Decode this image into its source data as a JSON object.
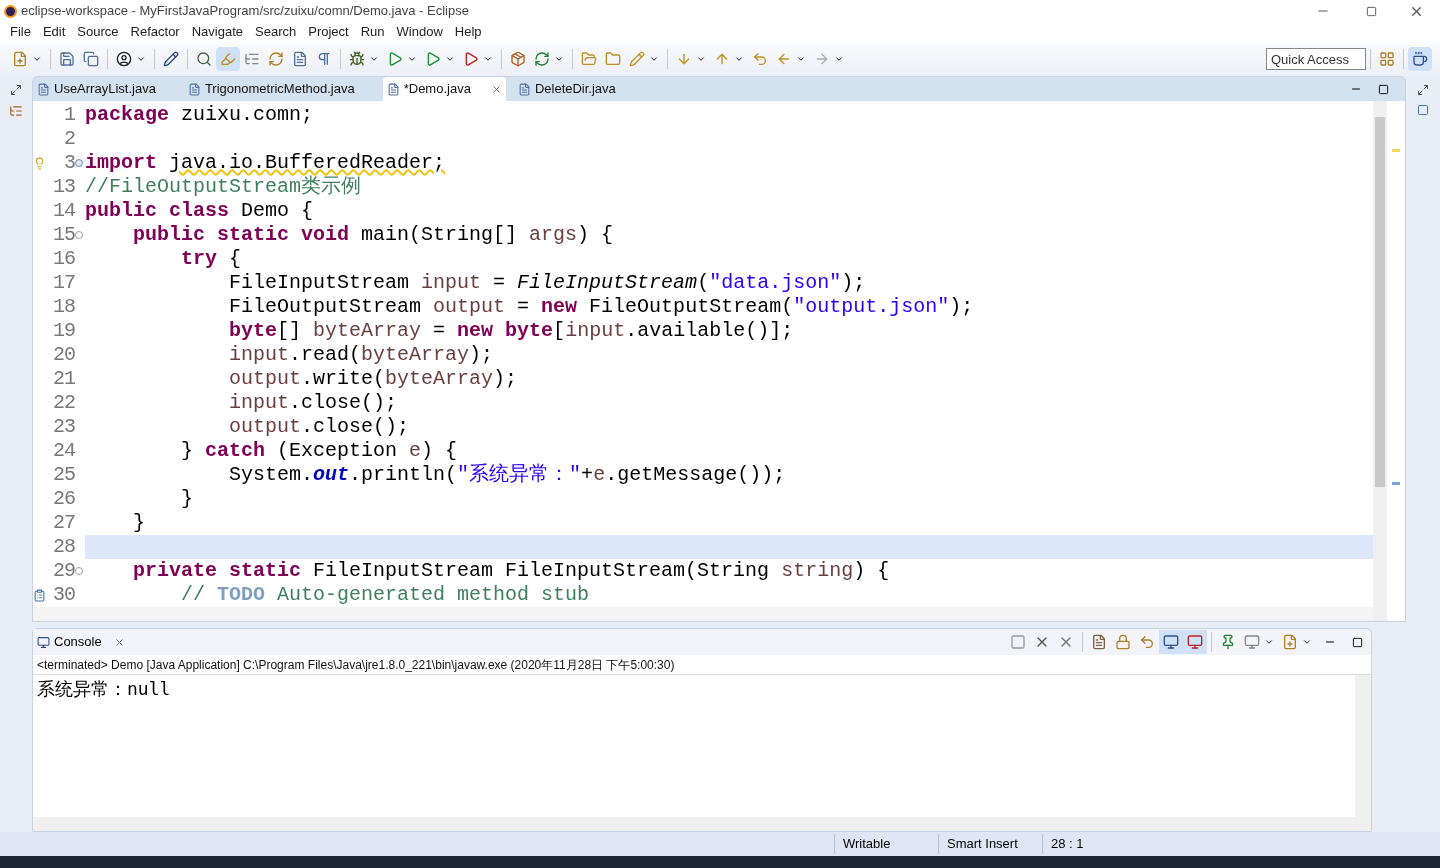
{
  "window": {
    "title": "eclipse-workspace - MyFirstJavaProgram/src/zuixu/comn/Demo.java - Eclipse"
  },
  "menu": [
    "File",
    "Edit",
    "Source",
    "Refactor",
    "Navigate",
    "Search",
    "Project",
    "Run",
    "Window",
    "Help"
  ],
  "quick_access": {
    "placeholder": "Quick Access"
  },
  "editor_tabs": [
    {
      "label": "UseArrayList.java",
      "selected": false
    },
    {
      "label": "TrigonometricMethod.java",
      "selected": false
    },
    {
      "label": "*Demo.java",
      "selected": true
    },
    {
      "label": "DeleteDir.java",
      "selected": false
    }
  ],
  "code_lines": [
    {
      "number": "1",
      "current": false,
      "tokens": [
        {
          "t": "package ",
          "kind": "keyword"
        },
        {
          "t": "zuixu.comn;",
          "kind": "plain"
        }
      ]
    },
    {
      "number": "2",
      "current": false
    },
    {
      "number": "3",
      "folded": true,
      "marker": {
        "kind": "warning"
      },
      "current": false,
      "tokens": [
        {
          "t": "import ",
          "kind": "keyword"
        },
        {
          "t": "java.io.BufferedReader;",
          "kind": "warning"
        }
      ]
    },
    {
      "number": "13",
      "current": false,
      "tokens": [
        {
          "t": "//FileOutputStream类示例",
          "kind": "comment"
        }
      ]
    },
    {
      "number": "14",
      "current": false,
      "tokens": [
        {
          "t": "public class ",
          "kind": "keyword"
        },
        {
          "t": "Demo {",
          "kind": "plain"
        }
      ]
    },
    {
      "number": "15",
      "folded": false,
      "current": false,
      "tokens": [
        {
          "t": "    public static void ",
          "kind": "keyword"
        },
        {
          "t": "main(String[] ",
          "kind": "plain"
        },
        {
          "t": "args",
          "kind": "variable"
        },
        {
          "t": ") {",
          "kind": "plain"
        }
      ]
    },
    {
      "number": "16",
      "current": false,
      "tokens": [
        {
          "t": "        try ",
          "kind": "keyword"
        },
        {
          "t": "{",
          "kind": "plain"
        }
      ]
    },
    {
      "number": "17",
      "current": false,
      "tokens": [
        {
          "t": "            FileInputStream ",
          "kind": "plain"
        },
        {
          "t": "input",
          "kind": "variable"
        },
        {
          "t": " = ",
          "kind": "plain"
        },
        {
          "t": "FileInputStream",
          "kind": "static"
        },
        {
          "t": "(",
          "kind": "plain"
        },
        {
          "t": "\"data.json\"",
          "kind": "string"
        },
        {
          "t": ");",
          "kind": "plain"
        }
      ]
    },
    {
      "number": "18",
      "current": false,
      "tokens": [
        {
          "t": "            FileOutputStream ",
          "kind": "plain"
        },
        {
          "t": "output",
          "kind": "variable"
        },
        {
          "t": " = ",
          "kind": "plain"
        },
        {
          "t": "new ",
          "kind": "keyword"
        },
        {
          "t": "FileOutputStream(",
          "kind": "plain"
        },
        {
          "t": "\"output.json\"",
          "kind": "string"
        },
        {
          "t": ");",
          "kind": "plain"
        }
      ]
    },
    {
      "number": "19",
      "current": false,
      "tokens": [
        {
          "t": "            byte",
          "kind": "keyword"
        },
        {
          "t": "[] ",
          "kind": "plain"
        },
        {
          "t": "byteArray",
          "kind": "variable"
        },
        {
          "t": " = ",
          "kind": "plain"
        },
        {
          "t": "new byte",
          "kind": "keyword"
        },
        {
          "t": "[",
          "kind": "plain"
        },
        {
          "t": "input",
          "kind": "variable"
        },
        {
          "t": ".available()];",
          "kind": "plain"
        }
      ]
    },
    {
      "number": "20",
      "current": false,
      "tokens": [
        {
          "t": "            input",
          "kind": "variable"
        },
        {
          "t": ".read(",
          "kind": "plain"
        },
        {
          "t": "byteArray",
          "kind": "variable"
        },
        {
          "t": ");",
          "kind": "plain"
        }
      ]
    },
    {
      "number": "21",
      "current": false,
      "tokens": [
        {
          "t": "            output",
          "kind": "variable"
        },
        {
          "t": ".write(",
          "kind": "plain"
        },
        {
          "t": "byteArray",
          "kind": "variable"
        },
        {
          "t": ");",
          "kind": "plain"
        }
      ]
    },
    {
      "number": "22",
      "current": false,
      "tokens": [
        {
          "t": "            input",
          "kind": "variable"
        },
        {
          "t": ".close();",
          "kind": "plain"
        }
      ]
    },
    {
      "number": "23",
      "current": false,
      "tokens": [
        {
          "t": "            output",
          "kind": "variable"
        },
        {
          "t": ".close();",
          "kind": "plain"
        }
      ]
    },
    {
      "number": "24",
      "current": false,
      "tokens": [
        {
          "t": "        } ",
          "kind": "plain"
        },
        {
          "t": "catch",
          "kind": "keyword"
        },
        {
          "t": " (Exception ",
          "kind": "plain"
        },
        {
          "t": "e",
          "kind": "variable"
        },
        {
          "t": ") {",
          "kind": "plain"
        }
      ]
    },
    {
      "number": "25",
      "current": false,
      "tokens": [
        {
          "t": "            System.",
          "kind": "plain"
        },
        {
          "t": "out",
          "kind": "field"
        },
        {
          "t": ".println(",
          "kind": "plain"
        },
        {
          "t": "\"系统异常：\"",
          "kind": "string"
        },
        {
          "t": "+",
          "kind": "plain"
        },
        {
          "t": "e",
          "kind": "variable"
        },
        {
          "t": ".getMessage());",
          "kind": "plain"
        }
      ]
    },
    {
      "number": "26",
      "current": false,
      "tokens": [
        {
          "t": "        }",
          "kind": "plain"
        }
      ]
    },
    {
      "number": "27",
      "current": false,
      "tokens": [
        {
          "t": "    }",
          "kind": "plain"
        }
      ]
    },
    {
      "number": "28",
      "current": true
    },
    {
      "number": "29",
      "folded": false,
      "current": false,
      "tokens": [
        {
          "t": "    private static ",
          "kind": "keyword"
        },
        {
          "t": "FileInputStream FileInputStream(String ",
          "kind": "plain"
        },
        {
          "t": "string",
          "kind": "variable"
        },
        {
          "t": ") {",
          "kind": "plain"
        }
      ]
    },
    {
      "number": "30",
      "marker": {
        "kind": "task"
      },
      "current": false,
      "tokens": [
        {
          "t": "        // ",
          "kind": "comment"
        },
        {
          "t": "TODO",
          "kind": "todo"
        },
        {
          "t": " Auto-generated method stub",
          "kind": "comment"
        }
      ]
    }
  ],
  "console": {
    "tab": {
      "label": "Console",
      "selected": true
    },
    "description": "<terminated> Demo [Java Application] C:\\Program Files\\Java\\jre1.8.0_221\\bin\\javaw.exe (2020年11月28日 下午5:00:30)",
    "output": "系统异常：null"
  },
  "status_bar": [
    "Writable",
    "Smart Insert",
    "28 : 1"
  ]
}
